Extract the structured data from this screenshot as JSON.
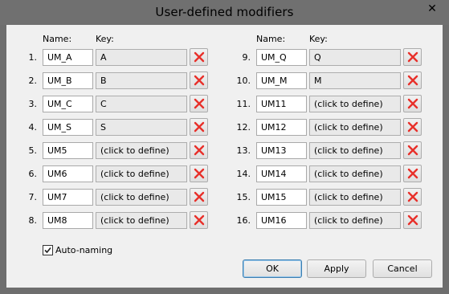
{
  "window": {
    "title": "User-defined modifiers",
    "close_glyph": "✕"
  },
  "headers": {
    "name": "Name:",
    "key": "Key:"
  },
  "left_rows": [
    {
      "num": "1.",
      "name": "UM_A",
      "key": "A"
    },
    {
      "num": "2.",
      "name": "UM_B",
      "key": "B"
    },
    {
      "num": "3.",
      "name": "UM_C",
      "key": "C"
    },
    {
      "num": "4.",
      "name": "UM_S",
      "key": "S"
    },
    {
      "num": "5.",
      "name": "UM5",
      "key": "(click to define)"
    },
    {
      "num": "6.",
      "name": "UM6",
      "key": "(click to define)"
    },
    {
      "num": "7.",
      "name": "UM7",
      "key": "(click to define)"
    },
    {
      "num": "8.",
      "name": "UM8",
      "key": "(click to define)"
    }
  ],
  "right_rows": [
    {
      "num": "9.",
      "name": "UM_Q",
      "key": "Q"
    },
    {
      "num": "10.",
      "name": "UM_M",
      "key": "M"
    },
    {
      "num": "11.",
      "name": "UM11",
      "key": "(click to define)"
    },
    {
      "num": "12.",
      "name": "UM12",
      "key": "(click to define)"
    },
    {
      "num": "13.",
      "name": "UM13",
      "key": "(click to define)"
    },
    {
      "num": "14.",
      "name": "UM14",
      "key": "(click to define)"
    },
    {
      "num": "15.",
      "name": "UM15",
      "key": "(click to define)"
    },
    {
      "num": "16.",
      "name": "UM16",
      "key": "(click to define)"
    }
  ],
  "auto_naming": {
    "label": "Auto-naming",
    "checked": true
  },
  "buttons": {
    "ok": "OK",
    "apply": "Apply",
    "cancel": "Cancel"
  },
  "icons": {
    "delete": "delete-x-icon"
  },
  "colors": {
    "delete_x": "#e8302a"
  }
}
